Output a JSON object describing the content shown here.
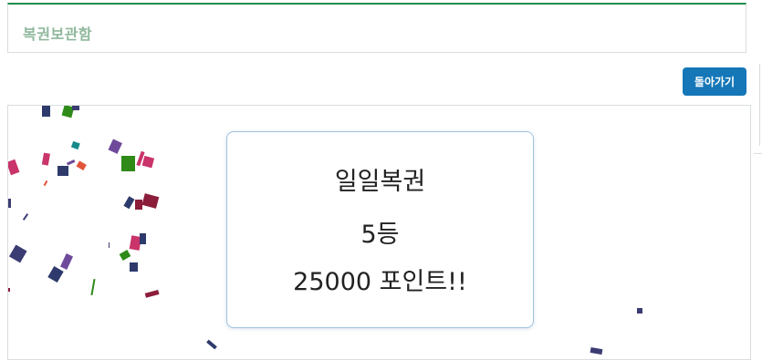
{
  "header": {
    "title": "복권보관함"
  },
  "toolbar": {
    "back_label": "돌아가기"
  },
  "result": {
    "lottery_name": "일일복권",
    "rank": "5등",
    "reward": "25000 포인트!!"
  },
  "confetti_colors": [
    "#2d3a6b",
    "#2f8a18",
    "#c9346a",
    "#6f4a9b",
    "#168a8a",
    "#e2543a",
    "#8b1c3a",
    "#3c3c74"
  ]
}
